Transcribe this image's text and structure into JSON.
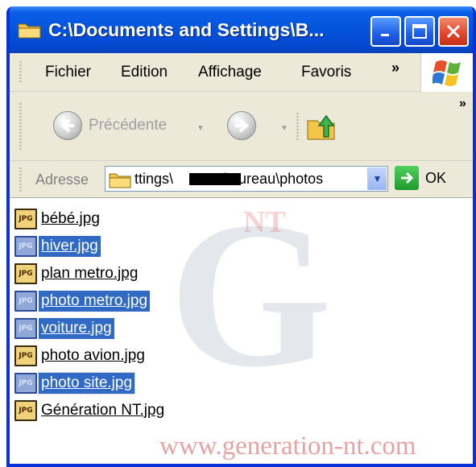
{
  "window": {
    "title": "C:\\Documents and Settings\\B..."
  },
  "menu": {
    "items": [
      "Fichier",
      "Edition",
      "Affichage",
      "Favoris"
    ],
    "more": "»"
  },
  "toolbar": {
    "back_label": "Précédente",
    "more": "»"
  },
  "address": {
    "label": "Adresse",
    "path_start": "ttings\\",
    "path_end": "\\Bureau\\photos",
    "go_label": "OK"
  },
  "files": [
    {
      "name": "bébé.jpg",
      "selected": false
    },
    {
      "name": "hiver.jpg",
      "selected": true
    },
    {
      "name": "plan metro.jpg",
      "selected": false
    },
    {
      "name": "photo metro.jpg",
      "selected": true
    },
    {
      "name": "voiture.jpg",
      "selected": true
    },
    {
      "name": "photo avion.jpg",
      "selected": false
    },
    {
      "name": "photo site.jpg",
      "selected": true
    },
    {
      "name": "Génération NT.jpg",
      "selected": false
    }
  ],
  "file_icon_text": "JPG",
  "watermark": {
    "logo_letter": "G",
    "logo_text": "NT",
    "url": "www.generation-nt.com"
  },
  "colors": {
    "titlebar": "#0553dc",
    "selection": "#316ac5",
    "close_button": "#e0452a"
  }
}
